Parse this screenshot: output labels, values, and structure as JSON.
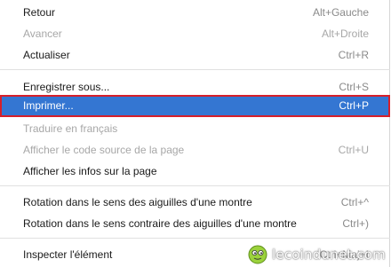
{
  "menu": {
    "items": [
      {
        "label": "Retour",
        "shortcut": "Alt+Gauche",
        "enabled": true
      },
      {
        "label": "Avancer",
        "shortcut": "Alt+Droite",
        "enabled": false
      },
      {
        "label": "Actualiser",
        "shortcut": "Ctrl+R",
        "enabled": true
      },
      {
        "label": "Enregistrer sous...",
        "shortcut": "Ctrl+S",
        "enabled": true
      },
      {
        "label": "Imprimer...",
        "shortcut": "Ctrl+P",
        "enabled": true,
        "selected": true
      },
      {
        "label": "Traduire en français",
        "shortcut": "",
        "enabled": false
      },
      {
        "label": "Afficher le code source de la page",
        "shortcut": "Ctrl+U",
        "enabled": false
      },
      {
        "label": "Afficher les infos sur la page",
        "shortcut": "",
        "enabled": true
      },
      {
        "label": "Rotation dans le sens des aiguilles d'une montre",
        "shortcut": "Ctrl+^",
        "enabled": true
      },
      {
        "label": "Rotation dans le sens contraire des aiguilles d'une montre",
        "shortcut": "Ctrl+)",
        "enabled": true
      },
      {
        "label": "Inspecter l'élément",
        "shortcut": "Ctrl+Maj+I",
        "enabled": true
      }
    ]
  },
  "watermark": {
    "text": "lecoindunet.com",
    "icon": "smiley-icon"
  },
  "colors": {
    "selection": "#3476d2",
    "selection_border": "#d61f2a",
    "disabled_text": "#a7a7a7"
  }
}
